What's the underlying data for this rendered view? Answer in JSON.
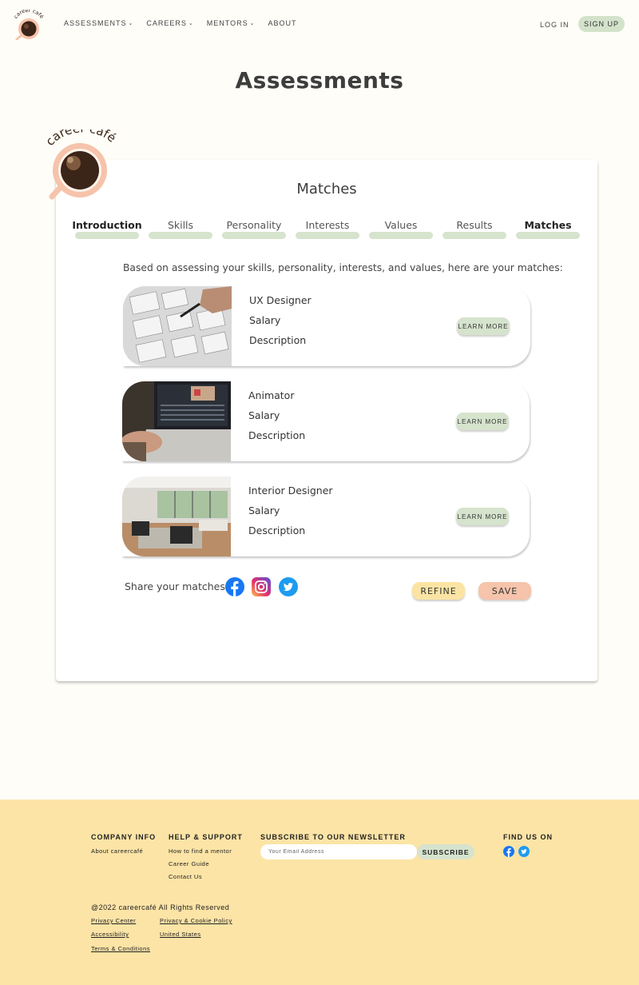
{
  "nav": {
    "items": [
      {
        "label": "ASSESSMENTS",
        "chevron": true
      },
      {
        "label": "CAREERS",
        "chevron": true
      },
      {
        "label": "MENTORS",
        "chevron": true
      },
      {
        "label": "ABOUT",
        "chevron": false
      }
    ],
    "login": "LOG IN",
    "signup": "SIGN UP"
  },
  "logo": {
    "text": "career café"
  },
  "page": {
    "title": "Assessments"
  },
  "card": {
    "title": "Matches",
    "steps": [
      "Introduction",
      "Skills",
      "Personality",
      "Interests",
      "Values",
      "Results",
      "Matches"
    ],
    "active_step": "Matches",
    "intro": "Based on assessing your skills, personality, interests, and values, here are your matches:",
    "matches": [
      {
        "title": "UX Designer",
        "salary": "Salary",
        "description": "Description",
        "button": "LEARN MORE"
      },
      {
        "title": "Animator",
        "salary": "Salary",
        "description": "Description",
        "button": "LEARN MORE"
      },
      {
        "title": "Interior Designer",
        "salary": "Salary",
        "description": "Description",
        "button": "LEARN MORE"
      }
    ],
    "share_label": "Share your matches",
    "social_icons": [
      "facebook-icon",
      "instagram-icon",
      "twitter-icon"
    ],
    "refine": "REFINE",
    "save": "SAVE"
  },
  "footer": {
    "company": {
      "heading": "COMPANY INFO",
      "links": [
        "About careercafé"
      ]
    },
    "help": {
      "heading": "HELP & SUPPORT",
      "links": [
        "How to find a mentor",
        "Career Guide",
        "Contact Us"
      ]
    },
    "newsletter": {
      "heading": "SUBSCRIBE TO OUR NEWSLETTER",
      "placeholder": "Your Email Address",
      "button": "SUBSCRIBE"
    },
    "find": {
      "heading": "FIND US ON"
    },
    "copyright": "@2022 careercafé All Rights Reserved",
    "legal": [
      "Privacy Center",
      "Privacy & Cookie Policy",
      "Accessibility",
      "United States",
      "Terms & Conditions"
    ]
  },
  "colors": {
    "background": "#fefdf7",
    "green": "#d6e3cd",
    "yellow": "#fbe4a3",
    "peach": "#f6c3ab",
    "footer": "#fce4a6",
    "coffee": "#3b2418"
  }
}
